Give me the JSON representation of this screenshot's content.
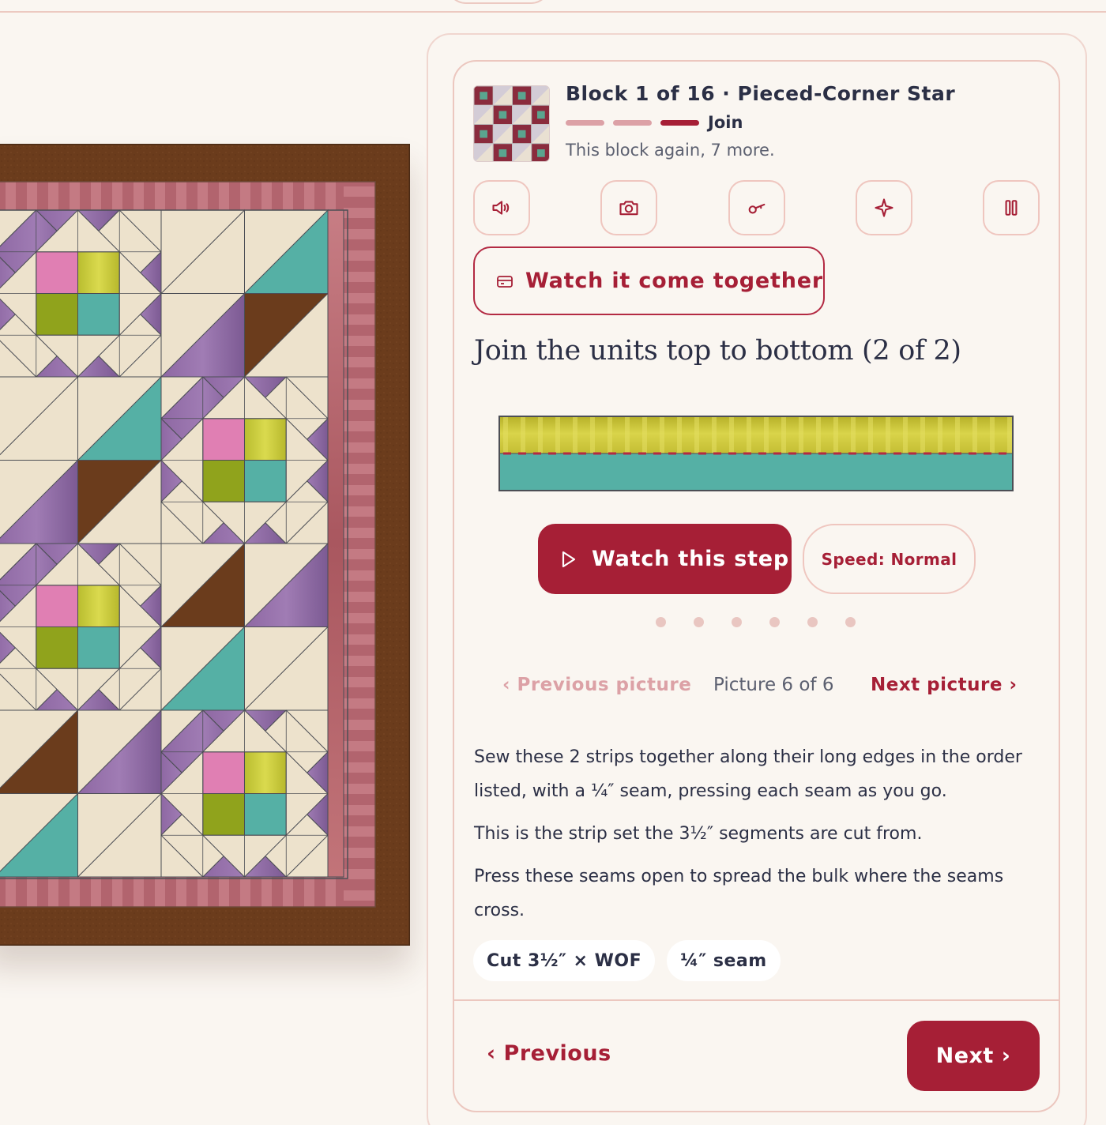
{
  "header": {
    "title": "Block 1 of 16 · Pieced-Corner Star",
    "progress_label": "Join",
    "progress_steps": 3,
    "progress_current": 3,
    "subtitle": "This block again, 7 more."
  },
  "toolbar": {
    "icons": [
      "speaker-icon",
      "camera-icon",
      "key-icon",
      "sparkle-icon",
      "pause-icon"
    ]
  },
  "watch_together": {
    "label": "Watch it come together",
    "icon": "sewing-machine-icon"
  },
  "step": {
    "title": "Join the units top to bottom (2 of 2)",
    "watch_label": "Watch this step",
    "speed_label": "Speed: Normal",
    "dots_count": 6
  },
  "picture_nav": {
    "prev_label": "‹ Previous picture",
    "count_label": "Picture 6 of 6",
    "next_label": "Next picture ›"
  },
  "instructions": {
    "paragraphs": [
      "Sew these 2 strips together along their long edges in the order listed, with a ¼″ seam, pressing each seam as you go.",
      "This is the strip set the 3½″ segments are cut from.",
      "Press these seams open to spread the bulk where the seams cross."
    ]
  },
  "chips": [
    "Cut 3½″ × WOF",
    "¼″ seam"
  ],
  "footer": {
    "prev_label": "‹ Previous",
    "next_label": "Next ›"
  },
  "colors": {
    "accent": "#a61f36",
    "accent_light": "#dca1a6",
    "text": "#2b2f45",
    "background": "#faf6f1",
    "strip_top": "#c9c33a",
    "strip_bottom": "#55b0a5"
  }
}
